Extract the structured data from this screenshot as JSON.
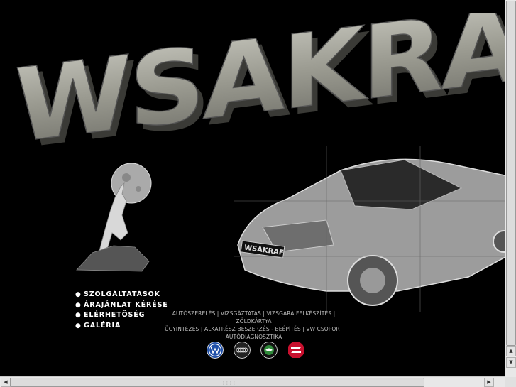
{
  "logo": {
    "text": "WSAKRAF"
  },
  "menu": {
    "bullet": "●",
    "items": [
      "SZOLGÁLTATÁSOK",
      "ÁRAJÁNLAT KÉRÉSE",
      "ELÉRHETŐSÉG",
      "GALÉRIA"
    ]
  },
  "services": {
    "line1": "AUTÓSZERELÉS | VIZSGÁZTATÁS | VIZSGÁRA FELKÉSZÍTÉS | ZÖLDKÁRTYA",
    "line2": "ÜGYINTÉZÉS | ALKATRÉSZ BESZERZÉS - BEÉPÍTÉS | VW CSOPORT",
    "line3": "AUTÓDIAGNOSZTIKA"
  },
  "car": {
    "plate": "WSAKRAF"
  },
  "brands": [
    "vw-logo",
    "audi-logo",
    "skoda-logo",
    "seat-logo"
  ],
  "colors": {
    "background": "#000000",
    "text": "#ffffff",
    "services_text": "#bbbbbb"
  }
}
